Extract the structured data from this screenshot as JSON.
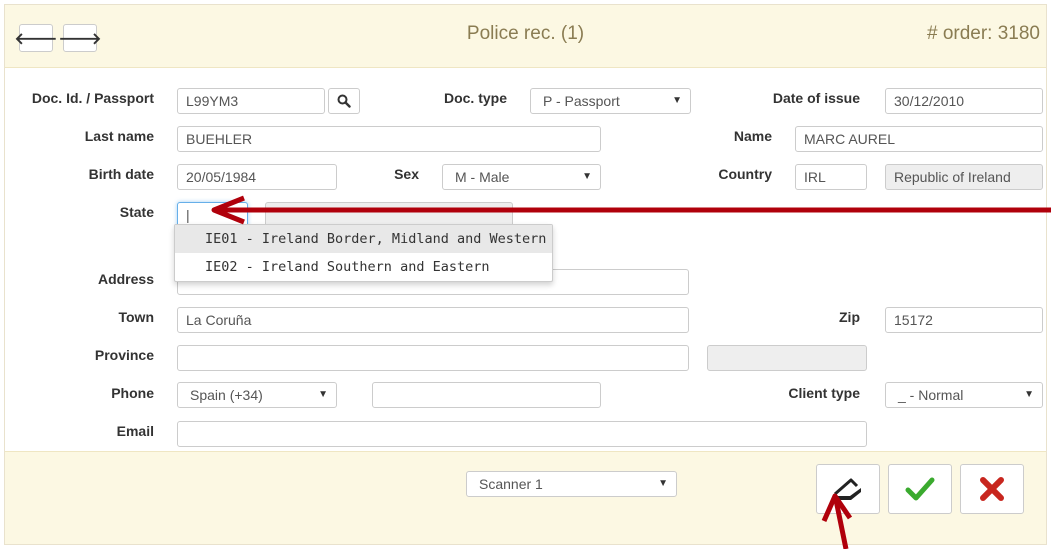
{
  "header": {
    "back_icon": "arrow-left-icon",
    "forward_icon": "arrow-right-icon",
    "back_glyph": "🡐",
    "forward_glyph": "🡒",
    "title": "Police rec. (1)",
    "order": "# order: 3180"
  },
  "form": {
    "doc_id_label": "Doc. Id. / Passport",
    "doc_id_value": "L99YM3",
    "doc_type_label": "Doc. type",
    "doc_type_value": "P - Passport",
    "date_issue_label": "Date of issue",
    "date_issue_value": "30/12/2010",
    "last_name_label": "Last name",
    "last_name_value": "BUEHLER",
    "name_label": "Name",
    "name_value": "MARC AUREL",
    "birth_label": "Birth date",
    "birth_value": "20/05/1984",
    "sex_label": "Sex",
    "sex_value": "M - Male",
    "country_label": "Country",
    "country_code": "IRL",
    "country_name": "Republic of Ireland",
    "state_label": "State",
    "state_value": "|",
    "address_label": "Address",
    "town_label": "Town",
    "town_value": "La Coruña",
    "zip_label": "Zip",
    "zip_value": "15172",
    "province_label": "Province",
    "phone_label": "Phone",
    "phone_prefix": "Spain (+34)",
    "client_type_label": "Client type",
    "client_type_value": "_ - Normal",
    "email_label": "Email"
  },
  "state_dropdown": {
    "options": [
      "IE01 - Ireland Border, Midland and Western",
      "IE02 - Ireland Southern and Eastern"
    ]
  },
  "footer": {
    "scanner_value": "Scanner 1",
    "scan_icon": "scanner-icon",
    "confirm_icon": "checkmark-icon",
    "cancel_icon": "close-icon"
  },
  "colors": {
    "header_bg": "#fcf8e3",
    "title_text": "#8a7c52",
    "annotation_arrow": "#b0000b",
    "confirm_green": "#3aaa2e",
    "cancel_red": "#c8261e"
  }
}
